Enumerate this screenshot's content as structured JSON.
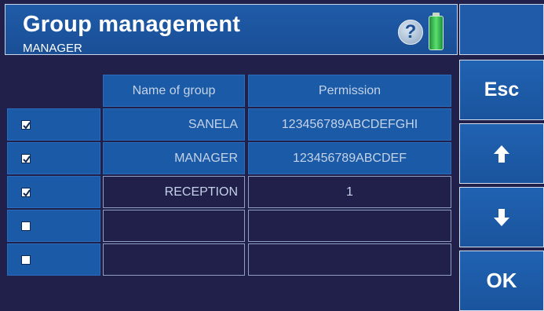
{
  "header": {
    "title": "Group management",
    "subtitle": "MANAGER"
  },
  "table": {
    "columns": [
      "Name of group",
      "Permission"
    ],
    "rows": [
      {
        "checked": true,
        "name": "SANELA",
        "permission": "123456789ABCDEFGHI",
        "style": "blue"
      },
      {
        "checked": true,
        "name": "MANAGER",
        "permission": "123456789ABCDEF",
        "style": "blue"
      },
      {
        "checked": true,
        "name": "RECEPTION",
        "permission": "1",
        "style": "dark"
      },
      {
        "checked": false,
        "name": "",
        "permission": "",
        "style": "dark"
      },
      {
        "checked": false,
        "name": "",
        "permission": "",
        "style": "dark"
      }
    ]
  },
  "buttons": {
    "esc": "Esc",
    "ok": "OK",
    "up_icon": "arrow-up-icon",
    "down_icon": "arrow-down-icon"
  },
  "icons": {
    "help": "?",
    "battery": "battery-icon"
  },
  "colors": {
    "background": "#20204a",
    "panel_blue": "#1b5aa6",
    "text_light": "#c4d3e8"
  }
}
